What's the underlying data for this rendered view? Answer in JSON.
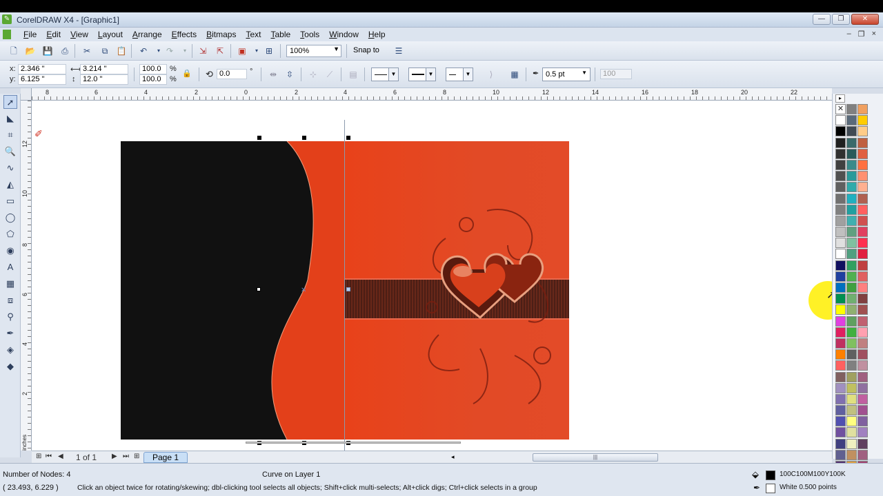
{
  "window": {
    "title": "CorelDRAW X4 - [Graphic1]",
    "controls": {
      "minimize": "—",
      "maximize": "❐",
      "close": "✕"
    }
  },
  "menu": {
    "items": [
      "File",
      "Edit",
      "View",
      "Layout",
      "Arrange",
      "Effects",
      "Bitmaps",
      "Text",
      "Table",
      "Tools",
      "Window",
      "Help"
    ],
    "doc_controls": {
      "minimize": "–",
      "restore": "❐",
      "close": "×"
    }
  },
  "standard_toolbar": {
    "zoom_level": "100%",
    "snap_to_label": "Snap to"
  },
  "property_bar": {
    "x_label": "x:",
    "x_value": "2.346 \"",
    "y_label": "y:",
    "y_value": "6.125 \"",
    "width_value": "3.214 \"",
    "height_value": "12.0 \"",
    "scale_x": "100.0",
    "scale_y": "100.0",
    "percent": "%",
    "rotation": "0.0",
    "degree": "°",
    "outline_width": "0.5 pt",
    "curve_smoothness": "100"
  },
  "ruler": {
    "horizontal_labels": [
      "8",
      "6",
      "4",
      "2",
      "0",
      "2",
      "4",
      "6",
      "8",
      "10",
      "12",
      "14",
      "16",
      "18",
      "20",
      "22"
    ],
    "vertical_labels": [
      "12",
      "10",
      "8",
      "6",
      "4",
      "2"
    ],
    "units": "inches"
  },
  "page_navigator": {
    "page_count": "1 of 1",
    "page_tab": "Page 1"
  },
  "status": {
    "nodes": "Number of Nodes: 4",
    "object_info": "Curve on Layer 1",
    "cursor_position": "( 23.493, 6.229 )",
    "hint": "Click an object twice for rotating/skewing; dbl-clicking tool selects all objects; Shift+click multi-selects; Alt+click digs; Ctrl+click selects in a group",
    "fill_info": "100C100M100Y100K",
    "outline_info": "White  0.500 points"
  },
  "colors": {
    "accent_red": "#e8421a",
    "black_panel": "#111111",
    "highlight": "#ffef00"
  },
  "palette_colors": [
    "#ffffff",
    "#808080",
    "#f0a060",
    "#8a4a8a",
    "#ffffff",
    "#5a6a7a",
    "#ffcc00",
    "#6a3a6a",
    "#000000",
    "#404a54",
    "#ffcc88",
    "#000000",
    "#202020",
    "#3a6a6a",
    "#c06040",
    "#ffffff",
    "#303030",
    "#2a5a5a",
    "#e06040",
    "#ffffff",
    "#404040",
    "#3a8a8a",
    "#ff7040",
    "#ffffff",
    "#505050",
    "#2a9a9a",
    "#ff9070",
    "#ffffff",
    "#606060",
    "#30aaaa",
    "#ffb090",
    "#ffffff",
    "#707070",
    "#20b0c0",
    "#b06050",
    "#ffffff",
    "#808080",
    "#20a0a0",
    "#ff6060",
    "#ffffff",
    "#a0a0a0",
    "#40b0b0",
    "#d05050",
    "#ffffff",
    "#c0c0c0",
    "#60a080",
    "#e04060",
    "#ffffff",
    "#e0e0e0",
    "#80c0a0",
    "#ff3050",
    "#ffffff",
    "#ffffff",
    "#50a080",
    "#e02040",
    "#ffffff",
    "#101060",
    "#30a060",
    "#c04040",
    "#ffffff",
    "#2040a0",
    "#50b050",
    "#e06060",
    "#ffffff",
    "#0070c0",
    "#40a040",
    "#ff8080",
    "#ffffff",
    "#009050",
    "#70b070",
    "#804040",
    "#ffffff",
    "#ffff00",
    "#90b070",
    "#a05050",
    "#ffffff",
    "#e040e0",
    "#60a060",
    "#c06070",
    "#ffffff",
    "#e02060",
    "#40b040",
    "#ffa0b0",
    "#ffffff",
    "#c03060",
    "#80c060",
    "#c08080",
    "#ffffff",
    "#ff8000",
    "#606060",
    "#a05060",
    "#ffffff",
    "#ff6060",
    "#808080",
    "#c090a0",
    "#ffffff",
    "#806060",
    "#a0a060",
    "#a06080",
    "#ffffff",
    "#a090c0",
    "#c0c060",
    "#9070a0",
    "#ffffff",
    "#8070b0",
    "#e0e080",
    "#c060a0",
    "#ffffff",
    "#6060a0",
    "#c0c080",
    "#a05090",
    "#ffffff",
    "#5050b0",
    "#ffff80",
    "#8060a0",
    "#ffffff",
    "#7050a0",
    "#e0e0a0",
    "#a080c0",
    "#ffffff",
    "#404080",
    "#f0f0c0",
    "#604060",
    "#ffffff",
    "#606090",
    "#c09060",
    "#a06080",
    "#ffffff",
    "#503070",
    "#e0a040",
    "#a04070",
    "#ffffff",
    "#404060",
    "#c08040",
    "#c04080",
    "#ffffff",
    "#2070c0",
    "#ff8040",
    "#a060a0",
    "#ffffff",
    "#40a0e0",
    "#e07030",
    "#7040a0",
    "#ffffff"
  ]
}
